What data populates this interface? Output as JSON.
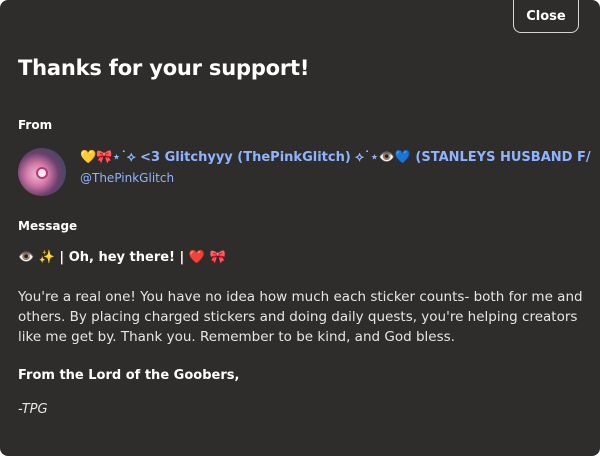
{
  "dialog": {
    "close_label": "Close",
    "title": "Thanks for your support!"
  },
  "from": {
    "label": "From",
    "display_name": "💛🎀⋆˙⟡ <3 Glitchyyy (ThePinkGlitch) ⟡˙⋆👁️💙 (STANLEYS HUSBAND F/",
    "handle": "@ThePinkGlitch"
  },
  "message": {
    "label": "Message",
    "heading": "👁️ ✨ | Oh, hey there! | ❤️ 🎀",
    "body": "You're a real one! You have no idea how much each sticker counts- both for me and others. By placing charged stickers and doing daily quests, you're helping creators like me get by. Thank you. Remember to be kind, and God bless.",
    "signoff": "From the Lord of the Goobers,",
    "signature": "-TPG"
  },
  "colors": {
    "background": "#2f2d2b",
    "accent_link": "#8fb4ff",
    "text": "#e6e6e6"
  }
}
